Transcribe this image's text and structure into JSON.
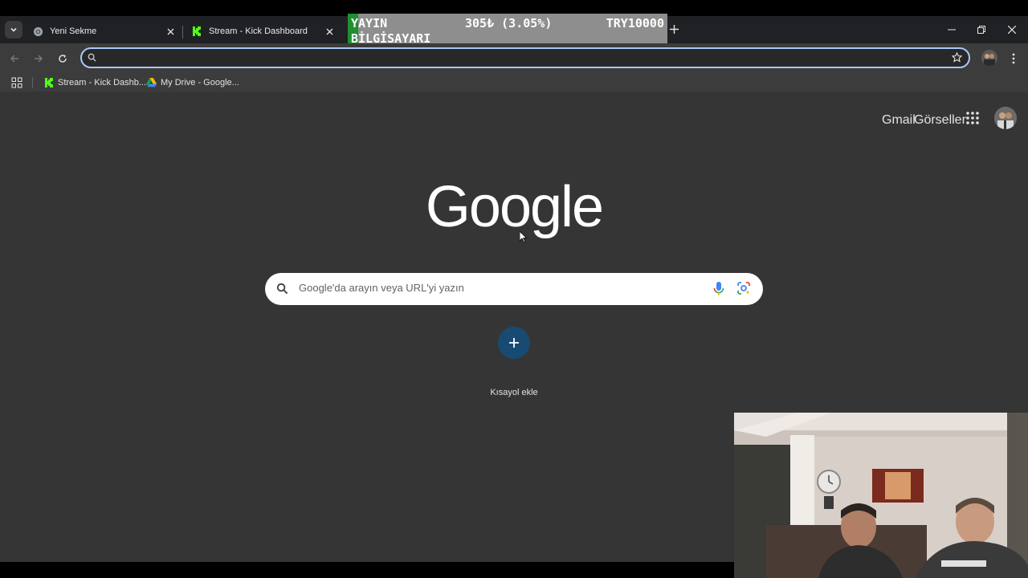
{
  "tabs": [
    {
      "title": "Yeni Sekme",
      "icon": "chrome-icon"
    },
    {
      "title": "Stream - Kick Dashboard",
      "icon": "kick-icon"
    }
  ],
  "overlay": {
    "line1": "YAYIN",
    "line2": "BİLGİSAYARI",
    "amount": "305₺ (3.05%)",
    "goal": "TRY10000"
  },
  "omnibox": {
    "value": "",
    "placeholder": ""
  },
  "bookmarks": [
    {
      "label": "Stream - Kick Dashb...",
      "icon": "kick-icon"
    },
    {
      "label": "My Drive - Google...",
      "icon": "drive-icon"
    }
  ],
  "page": {
    "top_links": [
      "Gmail",
      "Görseller"
    ],
    "logo": "Google",
    "search_placeholder": "Google'da arayın veya URL'yi yazın",
    "shortcut_label": "Kısayol ekle"
  },
  "colors": {
    "accent_focus": "#a8c7fa",
    "kick_green": "#53fc18",
    "shortcut_bg": "#174b73"
  }
}
